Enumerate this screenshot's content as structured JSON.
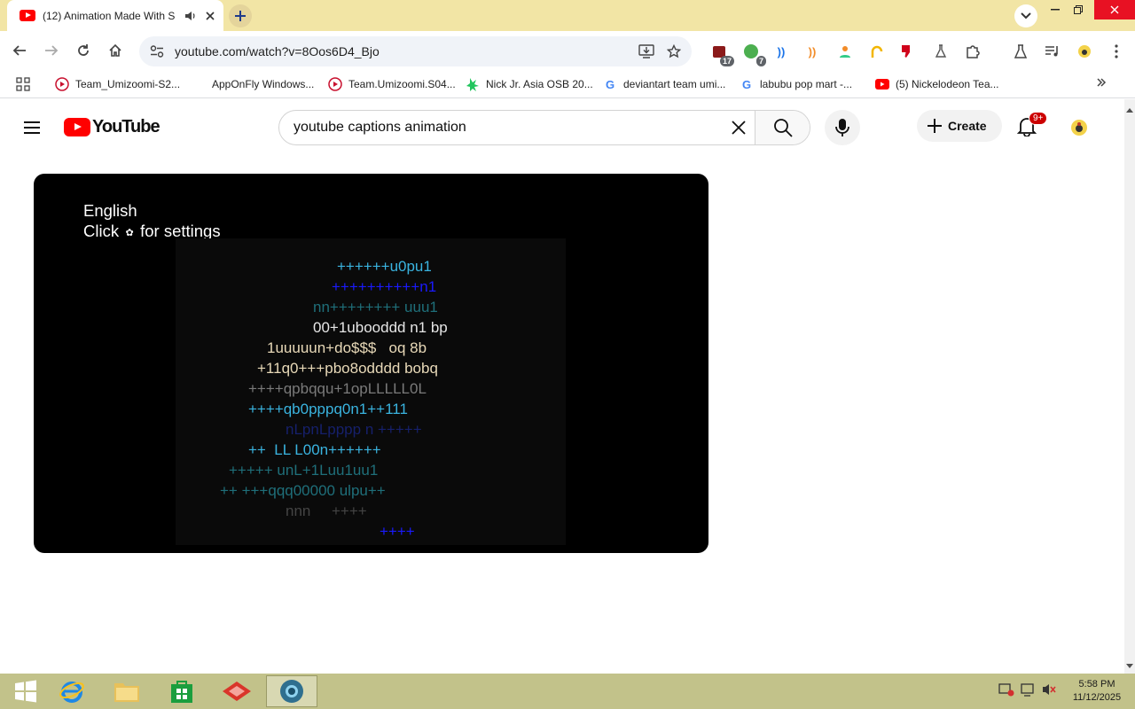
{
  "browser": {
    "tab": {
      "title": "(12) Animation Made With S"
    },
    "address": {
      "url": "youtube.com/watch?v=8Oos6D4_Bjo"
    },
    "extensions": [
      {
        "name": "ext-1",
        "badge": "17"
      },
      {
        "name": "ext-2",
        "badge": "7"
      }
    ],
    "bookmarks": [
      {
        "label": "Team_Umizoomi-S2..."
      },
      {
        "label": "AppOnFly Windows..."
      },
      {
        "label": "Team.Umizoomi.S04..."
      },
      {
        "label": "Nick Jr. Asia OSB 20..."
      },
      {
        "label": "deviantart team umi..."
      },
      {
        "label": "labubu pop mart -..."
      },
      {
        "label": "(5) Nickelodeon Tea..."
      }
    ]
  },
  "youtube": {
    "logo_text": "YouTube",
    "search": {
      "query": "youtube captions animation"
    },
    "create_label": "Create",
    "notifications_badge": "9+"
  },
  "player": {
    "caption_notice": {
      "language": "English",
      "click_word": "Click",
      "settings_text": "for settings"
    },
    "ascii_art": [
      "++++++u0pu1",
      "++++++++++n1",
      "nn++++++++ uuu1",
      "00+1ubooddd n1 bp",
      "1uuuuun+do$$$   oq 8b",
      "+11q0+++pbo8odddd bobq",
      "++++qpbqqu+1opLLLLL0L",
      "++++qb0pppq0n1++111",
      "nLpnLpppp n +++++",
      "++  LL L00n++++++",
      "+++++ unL+1Luu1uu1",
      "++ +++qqq00000 ulpu++",
      "nnn     ++++",
      "++++"
    ]
  },
  "taskbar": {
    "clock_time": "5:58 PM",
    "clock_date": "11/12/2025"
  },
  "colors": {
    "title_bar": "#f2e5a5",
    "youtube_red": "#ff0000",
    "taskbar": "#c2c28a"
  }
}
